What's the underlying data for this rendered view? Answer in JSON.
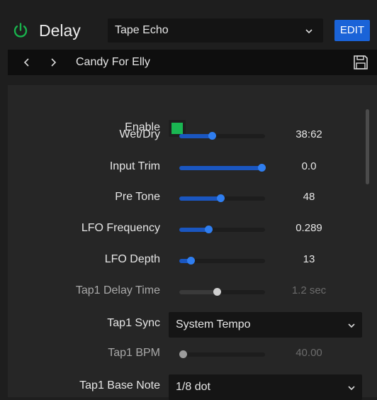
{
  "header": {
    "title": "Delay",
    "preset_type": "Tape Echo",
    "edit_label": "EDIT",
    "power_color": "#19b34d",
    "accent_color": "#1a63d8"
  },
  "nav": {
    "prev_icon": "chevron-left-icon",
    "next_icon": "chevron-right-icon",
    "preset_name": "Candy For Elly",
    "save_icon": "save-icon"
  },
  "params": {
    "enable": {
      "label": "Enable",
      "checked": true
    },
    "wet_dry": {
      "label": "Wet/Dry",
      "value": "38:62",
      "level": 0.38
    },
    "input_trim": {
      "label": "Input Trim",
      "value": "0.0",
      "level": 1.0
    },
    "pre_tone": {
      "label": "Pre Tone",
      "value": "48",
      "level": 0.48
    },
    "lfo_frequency": {
      "label": "LFO Frequency",
      "value": "0.289",
      "level": 0.34
    },
    "lfo_depth": {
      "label": "LFO Depth",
      "value": "13",
      "level": 0.13
    },
    "tap1_delay_time": {
      "label": "Tap1 Delay Time",
      "value": "1.2 sec",
      "level": 0.44,
      "disabled": true
    },
    "tap1_sync": {
      "label": "Tap1 Sync",
      "selected": "System Tempo"
    },
    "tap1_bpm": {
      "label": "Tap1 BPM",
      "value": "40.00",
      "level": 0.0,
      "disabled": true
    },
    "tap1_base_note": {
      "label": "Tap1 Base Note",
      "selected": "1/8 dot"
    }
  }
}
